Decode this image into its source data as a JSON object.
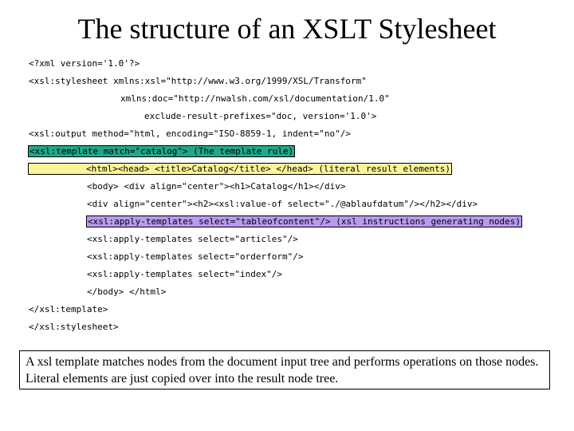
{
  "title": "The structure of an XSLT Stylesheet",
  "code": {
    "l1": "<?xml version='1.0'?>",
    "l2": "<xsl:stylesheet xmlns:xsl=\"http://www.w3.org/1999/XSL/Transform\"",
    "l3": "xmlns:doc=\"http://nwalsh.com/xsl/documentation/1.0\"",
    "l4": "exclude-result-prefixes=\"doc, version='1.0'>",
    "l5": "<xsl:output method=\"html, encoding=\"ISO-8859-1, indent=\"no\"/>",
    "l6": "<xsl:template match=\"catalog\"> (The template rule)",
    "l7": "<html><head> <title>Catalog</title> </head> (literal result elements)",
    "l8": "<body> <div align=\"center\"><h1>Catalog</h1></div>",
    "l9": "<div align=\"center\"><h2><xsl:value-of select=\"./@ablaufdatum\"/></h2></div>",
    "l10": "<xsl:apply-templates select=\"tableofcontent\"/> (xsl instructions generating nodes)",
    "l11": "<xsl:apply-templates select=\"articles\"/>",
    "l12": "<xsl:apply-templates select=\"orderform\"/>",
    "l13": "<xsl:apply-templates select=\"index\"/>",
    "l14": "</body> </html>",
    "l15": "</xsl:template>",
    "l16": "</xsl:stylesheet>"
  },
  "note": "A xsl template matches nodes from the document input tree and performs operations on those nodes. Literal elements are just copied over into the result node tree.",
  "colors": {
    "template_highlight": "#20a88a",
    "literal_highlight": "#fdf49a",
    "instruction_highlight": "#b89af0"
  }
}
